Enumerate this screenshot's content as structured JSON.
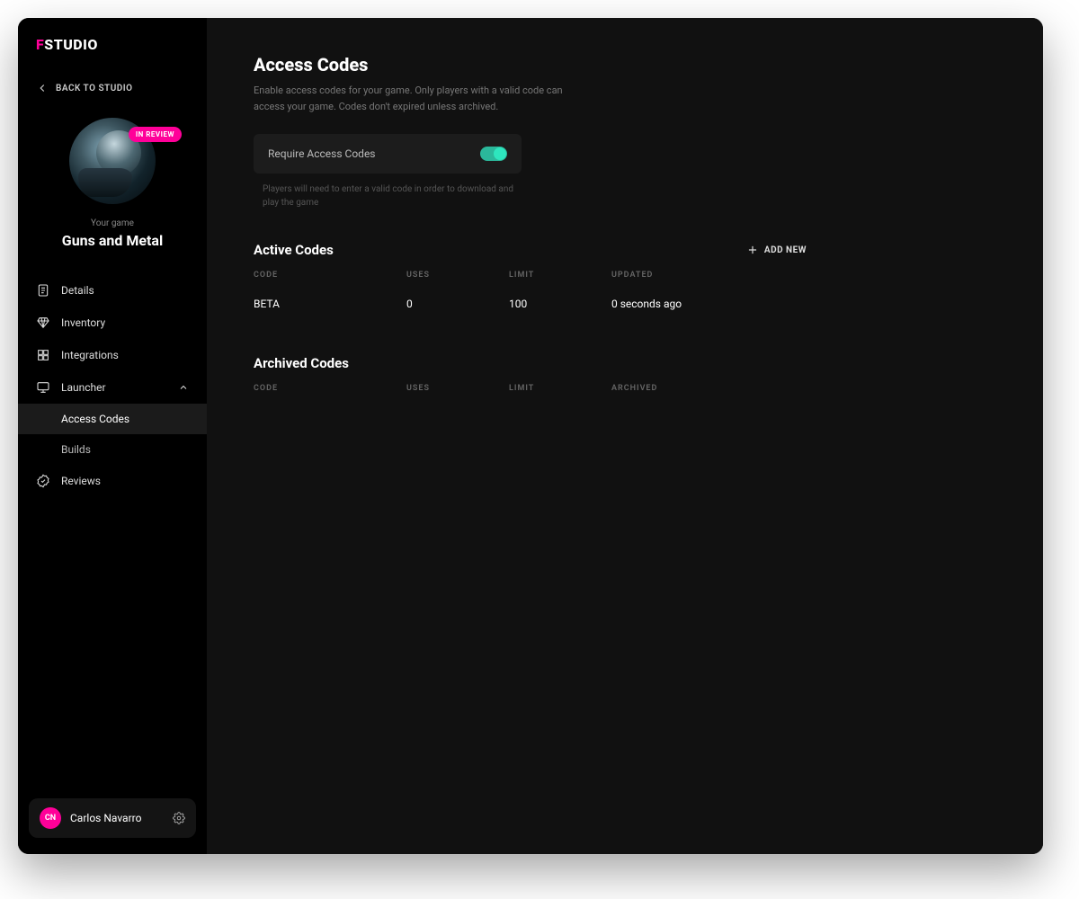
{
  "logo": {
    "prefix": "F",
    "rest": "STUDIO"
  },
  "sidebar": {
    "back_label": "BACK TO STUDIO",
    "badge": "IN REVIEW",
    "your_game_label": "Your game",
    "game_title": "Guns and Metal",
    "nav": {
      "details": "Details",
      "inventory": "Inventory",
      "integrations": "Integrations",
      "launcher": "Launcher",
      "access_codes": "Access Codes",
      "builds": "Builds",
      "reviews": "Reviews"
    }
  },
  "user": {
    "initials": "CN",
    "name": "Carlos Navarro"
  },
  "page": {
    "title": "Access Codes",
    "description": "Enable access codes for your game. Only players with a valid code can access your game. Codes don't expired unless archived.",
    "toggle_label": "Require Access Codes",
    "toggle_help": "Players will need to enter a valid code in order to download and play the game",
    "add_new_label": "ADD NEW",
    "active_codes_title": "Active Codes",
    "archived_codes_title": "Archived Codes",
    "columns": {
      "code": "CODE",
      "uses": "USES",
      "limit": "LIMIT",
      "updated": "UPDATED",
      "archived": "ARCHIVED"
    },
    "active_rows": [
      {
        "code": "BETA",
        "uses": "0",
        "limit": "100",
        "updated": "0 seconds ago"
      }
    ]
  }
}
